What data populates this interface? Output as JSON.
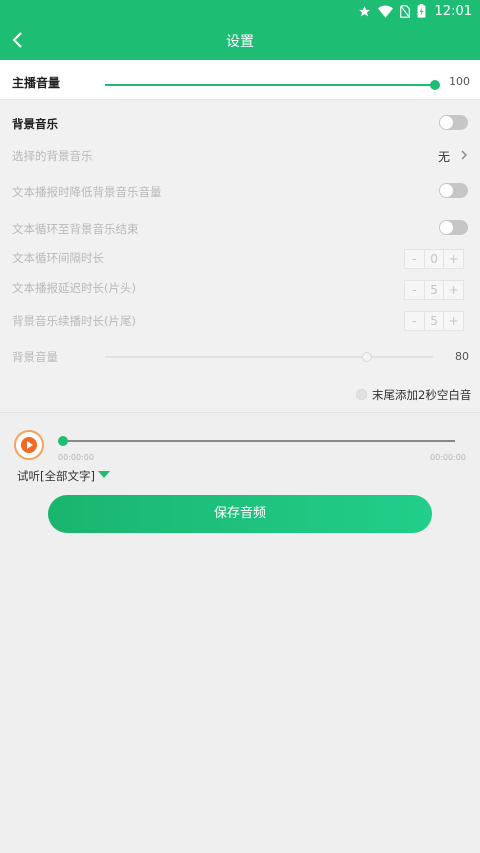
{
  "status_bar": {
    "time": "12:01",
    "icons": [
      "star-icon",
      "wifi-icon",
      "no-sim-icon",
      "battery-charging-icon"
    ]
  },
  "app_bar": {
    "title": "设置",
    "back_icon": "chevron-left-icon",
    "color": "#1dbd74"
  },
  "host_volume": {
    "label": "主播音量",
    "value": "100",
    "level": 1.0
  },
  "settings": {
    "bg_music": {
      "label": "背景音乐",
      "enabled": false
    },
    "select_bg_music": {
      "label": "选择的背景音乐",
      "value": "无"
    },
    "lower_bg_volume": {
      "label": "文本播报时降低背景音乐音量",
      "enabled": false
    },
    "loop_text": {
      "label": "文本循环至背景音乐结束",
      "enabled": false
    },
    "loop_interval": {
      "label": "文本循环间隔时长",
      "value": "0"
    },
    "report_delay": {
      "label": "文本播报延迟时长(片头)",
      "value": "5"
    },
    "bg_continue": {
      "label": "背景音乐续播时长(片尾)",
      "value": "5"
    },
    "stepper_minus": "-",
    "stepper_plus": "+",
    "bg_volume": {
      "label": "背景音量",
      "value": "80",
      "level": 0.8
    },
    "tail_silence": {
      "label": "末尾添加2秒空白音",
      "checked": false
    }
  },
  "player": {
    "start_time": "00:00:00",
    "end_time": "00:00:00",
    "progress": 0,
    "preview_label": "试听[全部文字]"
  },
  "save_button": {
    "label": "保存音频"
  },
  "colors": {
    "accent": "#1dbd74",
    "play": "#f06a26",
    "disabled_text": "#b9b9b9"
  }
}
